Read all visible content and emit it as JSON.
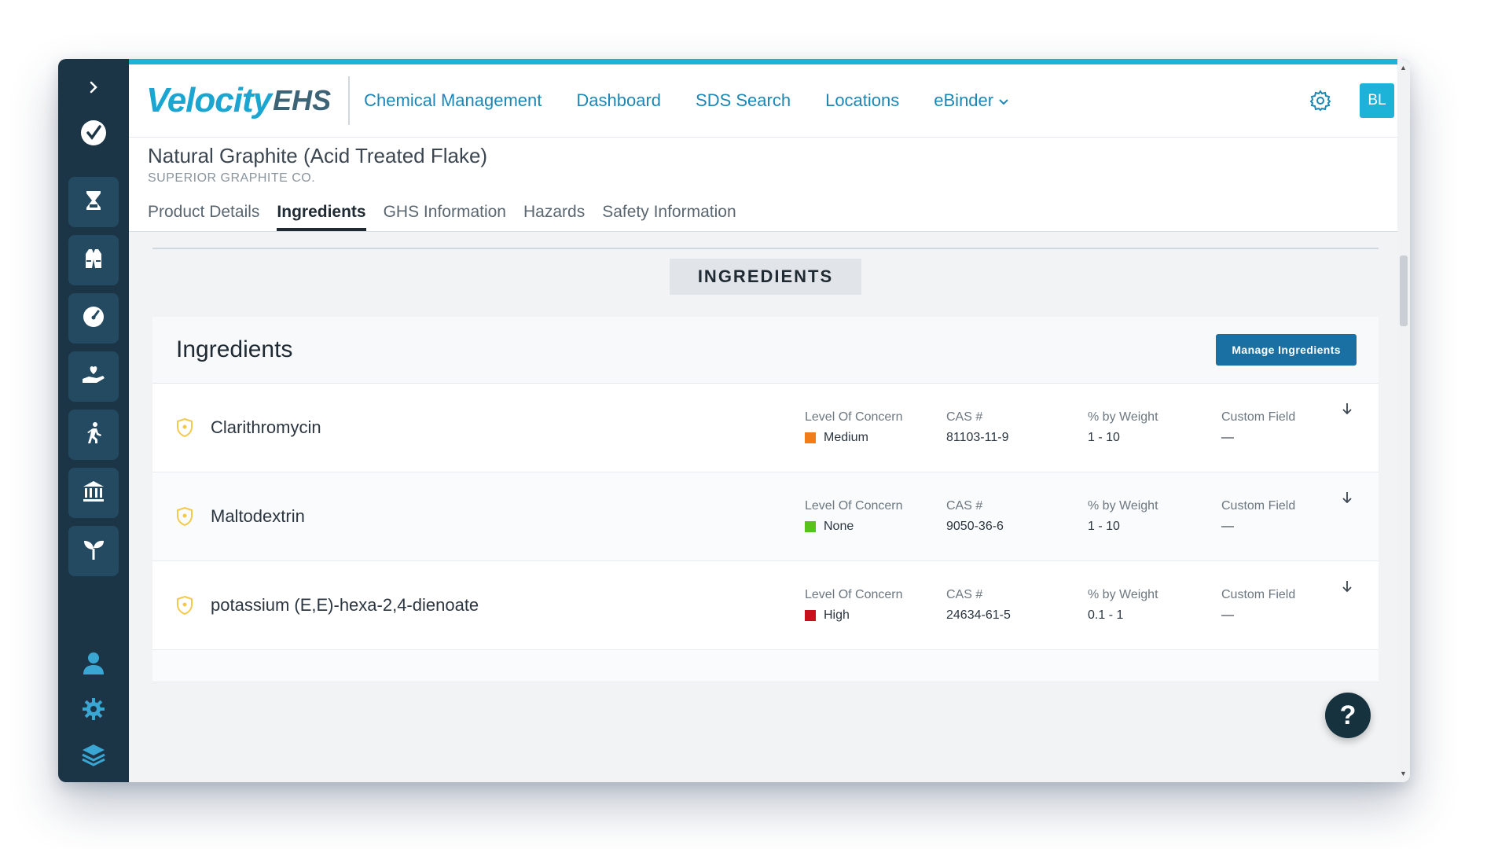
{
  "sidebar": {
    "top_icons": [
      "chevron-right-icon",
      "checkmark-logo-icon"
    ],
    "modules": [
      {
        "icon": "hourglass-icon"
      },
      {
        "icon": "safety-vest-icon"
      },
      {
        "icon": "gauge-icon"
      },
      {
        "icon": "care-hand-icon"
      },
      {
        "icon": "walking-person-icon"
      },
      {
        "icon": "bank-building-icon"
      },
      {
        "icon": "sprout-icon"
      }
    ],
    "bottom_icons": [
      "user-icon",
      "gear-icon",
      "layers-icon"
    ]
  },
  "brand": {
    "velocity": "Velocity",
    "ehs": "EHS"
  },
  "nav": {
    "items": [
      "Chemical Management",
      "Dashboard",
      "SDS Search",
      "Locations",
      "eBinder"
    ]
  },
  "user": {
    "initials": "BL"
  },
  "product": {
    "name": "Natural Graphite (Acid Treated Flake)",
    "manufacturer": "SUPERIOR GRAPHITE CO."
  },
  "tabs": [
    "Product Details",
    "Ingredients",
    "GHS Information",
    "Hazards",
    "Safety Information"
  ],
  "active_tab": "Ingredients",
  "section_label": "INGREDIENTS",
  "card": {
    "title": "Ingredients",
    "manage_button": "Manage Ingredients"
  },
  "column_labels": {
    "level": "Level Of Concern",
    "cas": "CAS #",
    "weight": "% by Weight",
    "custom": "Custom Field"
  },
  "ingredients": [
    {
      "name": "Clarithromycin",
      "level": "Medium",
      "level_color": "#f07c1a",
      "cas": "81103-11-9",
      "weight": "1 - 10",
      "custom": "—"
    },
    {
      "name": "Maltodextrin",
      "level": "None",
      "level_color": "#57c21a",
      "cas": "9050-36-6",
      "weight": "1 - 10",
      "custom": "—"
    },
    {
      "name": "potassium (E,E)-hexa-2,4-dienoate",
      "level": "High",
      "level_color": "#c8101e",
      "cas": "24634-61-5",
      "weight": "0.1 - 1",
      "custom": "—"
    }
  ],
  "colors": {
    "sidebar": "#1b3547",
    "accent": "#1db3d8",
    "nav_link": "#1e86b3",
    "button": "#1a6fa3",
    "shield": "#f4c94a"
  },
  "help": {
    "label": "?"
  }
}
